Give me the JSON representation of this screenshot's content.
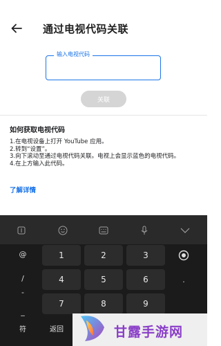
{
  "header": {
    "title": "通过电视代码关联"
  },
  "code_input": {
    "label": "输入电视代码",
    "value": ""
  },
  "link_button": {
    "label": "关联"
  },
  "instructions": {
    "title": "如何获取电视代码",
    "steps": [
      "1.在电视设备上打开 YouTube 应用。",
      "2.转到“设置”。",
      "3.向下滚动至通过电视代码关联。电视上会显示蓝色的电视代码。",
      "4.在上方输入此代码。"
    ],
    "learn_more": "了解详情"
  },
  "keyboard": {
    "toolbar_icons": [
      "text-cursor-icon",
      "emoji-icon",
      "keyboard-icon",
      "microphone-icon",
      "chevron-down-icon"
    ],
    "left_keys": [
      "@",
      "/",
      "-",
      "_"
    ],
    "number_keys": [
      "1",
      "2",
      "3",
      "4",
      "5",
      "6",
      "7",
      "8",
      "9"
    ],
    "right_keys": [
      ".",
      ","
    ],
    "symbols_key": "符",
    "back_key": "返回"
  },
  "watermark": {
    "text": "甘露手游网"
  }
}
